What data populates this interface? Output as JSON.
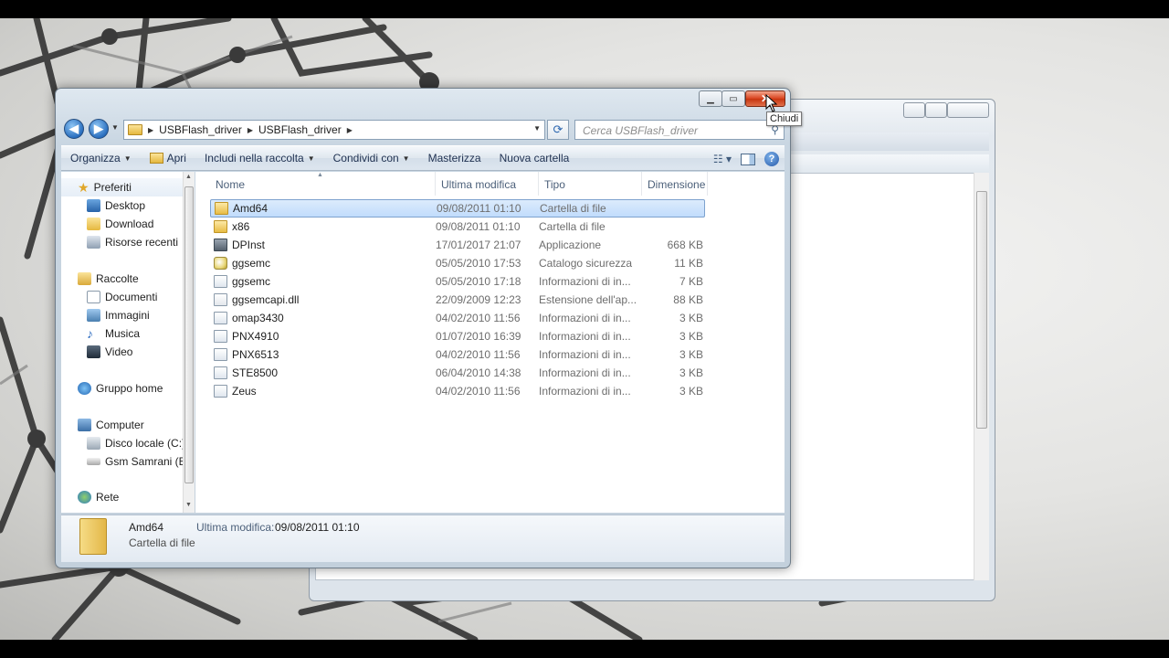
{
  "tooltip": "Chiudi",
  "address": {
    "crumbs": [
      "USBFlash_driver",
      "USBFlash_driver"
    ],
    "search_placeholder": "Cerca USBFlash_driver"
  },
  "toolbar": {
    "organize": "Organizza",
    "open": "Apri",
    "include": "Includi nella raccolta",
    "share": "Condividi con",
    "burn": "Masterizza",
    "new_folder": "Nuova cartella"
  },
  "nav": {
    "favorites": "Preferiti",
    "desktop": "Desktop",
    "download": "Download",
    "recent": "Risorse recenti",
    "libraries": "Raccolte",
    "documents": "Documenti",
    "pictures": "Immagini",
    "music": "Musica",
    "video": "Video",
    "homegroup": "Gruppo home",
    "computer": "Computer",
    "disk_c": "Disco locale (C:)",
    "disk_e": "Gsm Samrani (E:)",
    "network": "Rete"
  },
  "columns": {
    "name": "Nome",
    "modified": "Ultima modifica",
    "type": "Tipo",
    "size": "Dimensione"
  },
  "files": [
    {
      "name": "Amd64",
      "modified": "09/08/2011 01:10",
      "type": "Cartella di file",
      "size": "",
      "icon": "folder-icon"
    },
    {
      "name": "x86",
      "modified": "09/08/2011 01:10",
      "type": "Cartella di file",
      "size": "",
      "icon": "folder-icon"
    },
    {
      "name": "DPInst",
      "modified": "17/01/2017 21:07",
      "type": "Applicazione",
      "size": "668 KB",
      "icon": "application-icon"
    },
    {
      "name": "ggsemc",
      "modified": "05/05/2010 17:53",
      "type": "Catalogo sicurezza",
      "size": "11 KB",
      "icon": "security-catalog-icon"
    },
    {
      "name": "ggsemc",
      "modified": "05/05/2010 17:18",
      "type": "Informazioni di in...",
      "size": "7 KB",
      "icon": "setup-info-icon"
    },
    {
      "name": "ggsemcapi.dll",
      "modified": "22/09/2009 12:23",
      "type": "Estensione dell'ap...",
      "size": "88 KB",
      "icon": "dll-icon"
    },
    {
      "name": "omap3430",
      "modified": "04/02/2010 11:56",
      "type": "Informazioni di in...",
      "size": "3 KB",
      "icon": "setup-info-icon"
    },
    {
      "name": "PNX4910",
      "modified": "01/07/2010 16:39",
      "type": "Informazioni di in...",
      "size": "3 KB",
      "icon": "setup-info-icon"
    },
    {
      "name": "PNX6513",
      "modified": "04/02/2010 11:56",
      "type": "Informazioni di in...",
      "size": "3 KB",
      "icon": "setup-info-icon"
    },
    {
      "name": "STE8500",
      "modified": "06/04/2010 14:38",
      "type": "Informazioni di in...",
      "size": "3 KB",
      "icon": "setup-info-icon"
    },
    {
      "name": "Zeus",
      "modified": "04/02/2010 11:56",
      "type": "Informazioni di in...",
      "size": "3 KB",
      "icon": "setup-info-icon"
    }
  ],
  "details": {
    "name": "Amd64",
    "type": "Cartella di file",
    "modified_label": "Ultima modifica:",
    "modified_value": "09/08/2011 01:10"
  },
  "colors": {
    "selection": "#c1dcfc",
    "close_button": "#c7350f",
    "accent": "#2a6fbf"
  }
}
